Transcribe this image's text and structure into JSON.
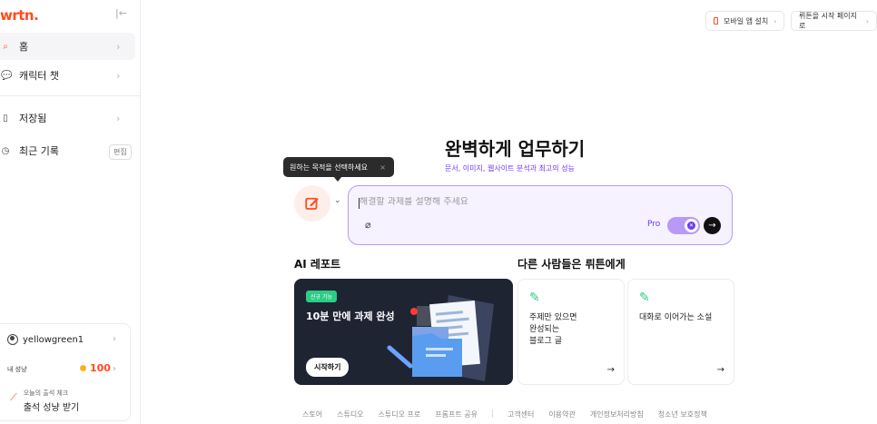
{
  "brand": {
    "logo": "wrtn.",
    "accent": "#ff4b1f",
    "purple": "#6c3cf0"
  },
  "sidebar": {
    "items": [
      {
        "label": "홈",
        "icon": "search-icon",
        "active": true
      },
      {
        "label": "캐릭터 챗",
        "icon": "chat-icon",
        "active": false
      },
      {
        "label": "저장됨",
        "icon": "bookmark-icon",
        "active": false
      },
      {
        "label": "최근 기록",
        "icon": "clock-icon",
        "active": false
      }
    ],
    "edit_label": "편집",
    "profile": {
      "username": "yellowgreen1",
      "points_label": "내 성냥",
      "points_value": "100",
      "checkin_sub": "오늘의 출석 체크",
      "checkin_main": "출석 성냥 받기"
    }
  },
  "topbar": {
    "mobile_app": "모바일 앱 설치",
    "start_page": "뤼튼을 시작 페이지로"
  },
  "hero": {
    "title": "완벽하게 업무하기",
    "subtitle": "문서, 이미지, 웹사이트 분석과 최고의 성능"
  },
  "tooltip": {
    "text": "원하는 목적을 선택하세요",
    "close": "×"
  },
  "prompt": {
    "placeholder": "해결할 과제를 설명해 주세요",
    "pro_label": "Pro"
  },
  "ai_report": {
    "section_title": "AI 레포트",
    "badge": "신규 기능",
    "title": "10분 만에 과제 완성",
    "button": "시작하기"
  },
  "others": {
    "section_title": "다른 사람들은 뤼튼에게",
    "cards": [
      {
        "text": "주제만 있으면\n완성되는\n블로그 글"
      },
      {
        "text": "대화로 이어가는 소설"
      }
    ]
  },
  "footer": {
    "links_left": [
      "스토어",
      "스튜디오",
      "스튜디오 프로",
      "프롬프트 공유"
    ],
    "links_right": [
      "고객센터",
      "이용약관",
      "개인정보처리방침",
      "청소년 보호정책"
    ]
  }
}
